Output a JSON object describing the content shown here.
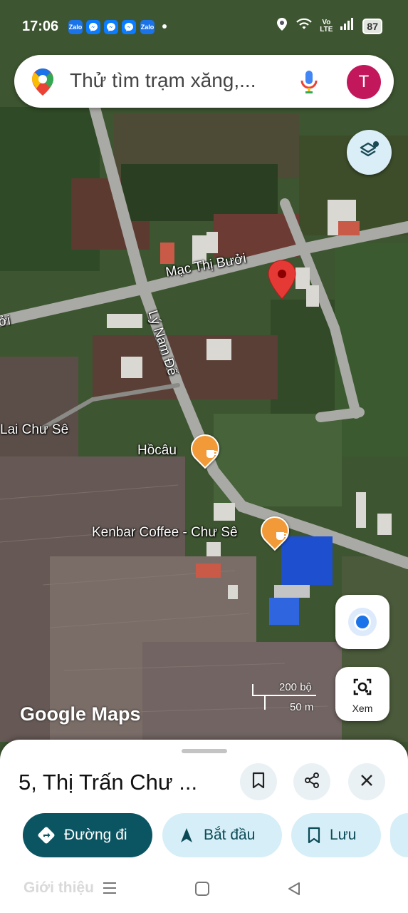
{
  "status_bar": {
    "time": "17:06",
    "battery": "87",
    "network": "VoLTE",
    "network_line1": "Vo",
    "network_line2": "LTE",
    "notification_icons": [
      "zalo-icon",
      "messenger-icon",
      "messenger-icon",
      "messenger-icon",
      "zalo-icon"
    ],
    "zalo_text": "Zalo"
  },
  "search": {
    "placeholder": "Thử tìm trạm xăng,...",
    "avatar_letter": "T"
  },
  "map": {
    "street_labels": [
      "Mạc Thị Bưởi",
      "Lý Nam Đế",
      "Lai Chư Sê",
      "ởi"
    ],
    "places": [
      {
        "name": "Hồcâu",
        "icon": "coffee-icon"
      },
      {
        "name": "Kenbar Coffee - Chư Sê",
        "icon": "coffee-icon"
      }
    ],
    "scale": {
      "imperial": "200 bộ",
      "metric": "50 m"
    },
    "logo": "Google Maps",
    "lens_label": "Xem",
    "pin_color": "#e53935",
    "place_color": "#f29a38"
  },
  "sheet": {
    "title": "5, Thị Trấn Chư ...",
    "actions": [
      {
        "label": "Đường đi",
        "icon": "directions-icon"
      },
      {
        "label": "Bắt đầu",
        "icon": "navigation-arrow-icon"
      },
      {
        "label": "Lưu",
        "icon": "bookmark-icon"
      }
    ],
    "tab": "Giới thiệu"
  },
  "colors": {
    "primary_chip": "#0b5563",
    "secondary_chip": "#d6eef7",
    "avatar": "#c2185b"
  }
}
